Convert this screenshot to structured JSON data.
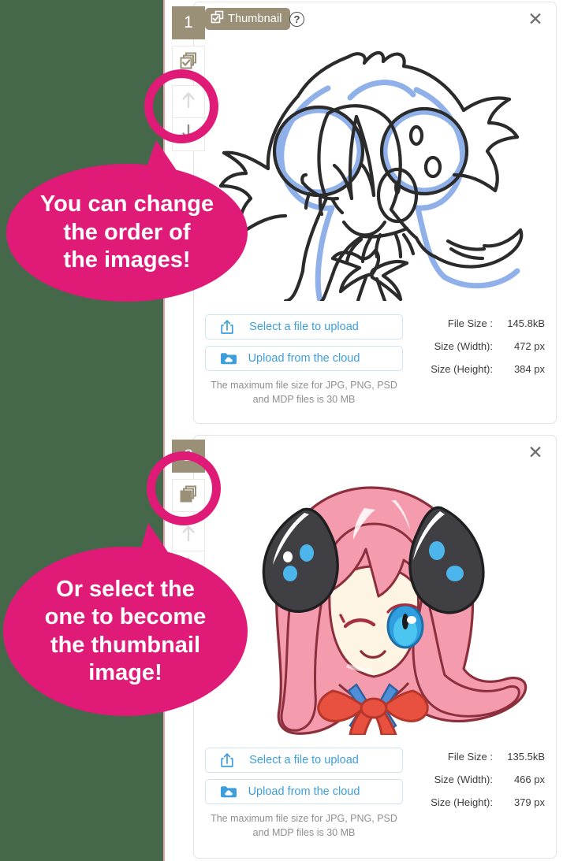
{
  "cards": [
    {
      "index": "1",
      "thumbnail_badge": {
        "label": "Thumbnail",
        "icon": "stack-check-icon",
        "help_icon": "question-mark-icon"
      },
      "close_icon": "close-icon",
      "rail": {
        "stack_icon": "stack-check-icon",
        "move_up_icon": "arrow-up-icon",
        "move_down_icon": "arrow-down-icon",
        "stack_checked": true
      },
      "preview_alt": "black-and-white line-art sketch of an anime girl with horns and a bow",
      "buttons": [
        {
          "label": "Select a file to upload",
          "icon": "upload-box-icon"
        },
        {
          "label": "Upload from the cloud",
          "icon": "cloud-folder-icon"
        }
      ],
      "note": "The maximum file size for JPG, PNG, PSD and MDP files is 30 MB",
      "meta": [
        {
          "label": "File Size :",
          "value": "145.8kB"
        },
        {
          "label": "Size (Width):",
          "value": "472 px"
        },
        {
          "label": "Size (Height):",
          "value": "384 px"
        }
      ]
    },
    {
      "index": "2",
      "thumbnail_badge": null,
      "close_icon": "close-icon",
      "rail": {
        "stack_icon": "stack-icon",
        "move_up_icon": "arrow-up-icon",
        "move_down_icon": "arrow-down-icon",
        "stack_checked": false
      },
      "preview_alt": "colored illustration of a pink-haired anime girl with black horns and a red bow",
      "buttons": [
        {
          "label": "Select a file to upload",
          "icon": "upload-box-icon"
        },
        {
          "label": "Upload from the cloud",
          "icon": "cloud-folder-icon"
        }
      ],
      "note": "The maximum file size for JPG, PNG, PSD and MDP files is 30 MB",
      "meta": [
        {
          "label": "File Size :",
          "value": "135.5kB"
        },
        {
          "label": "Size (Width):",
          "value": "466 px"
        },
        {
          "label": "Size (Height):",
          "value": "379 px"
        }
      ]
    }
  ],
  "annotations": [
    {
      "id": "order-callout",
      "lines": [
        "You can change",
        "the order of",
        "the images!"
      ],
      "text": "You can change the order of the images!"
    },
    {
      "id": "thumbnail-callout",
      "lines": [
        "Or select the",
        "one to become",
        "the thumbnail",
        "image!"
      ],
      "text": "Or select the one to become the thumbnail image!"
    }
  ],
  "colors": {
    "accent_pink": "#e01a77",
    "badge_brown": "#9a9078",
    "link_blue": "#3d9edb",
    "panel_green": "#46684a"
  }
}
